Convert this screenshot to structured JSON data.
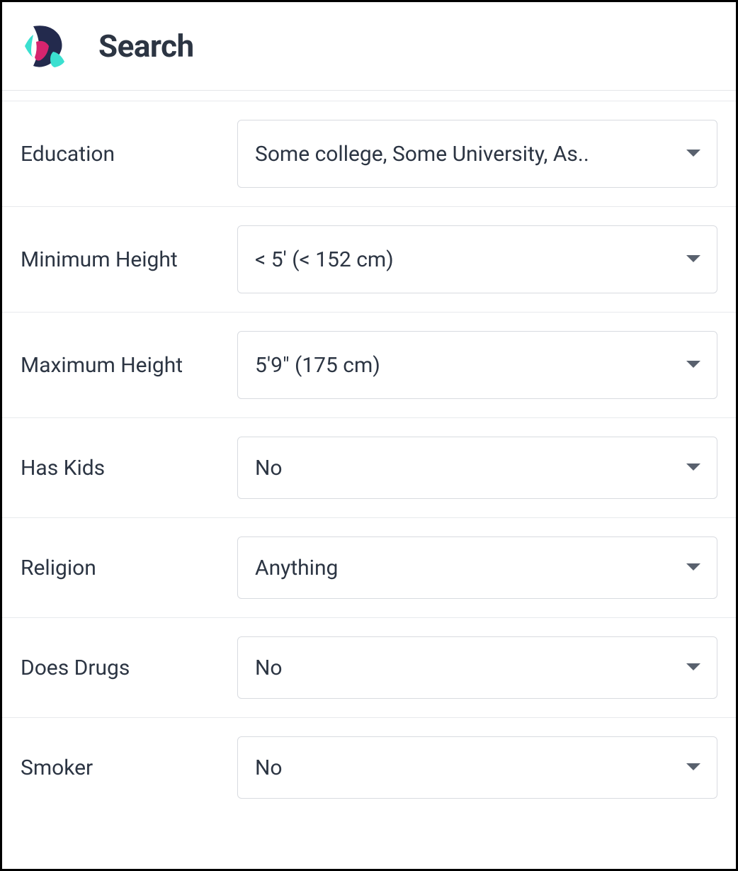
{
  "header": {
    "title": "Search"
  },
  "filters": {
    "education": {
      "label": "Education",
      "value": "Some college, Some University, As.."
    },
    "min_height": {
      "label": "Minimum Height",
      "value": "< 5' (< 152 cm)"
    },
    "max_height": {
      "label": "Maximum Height",
      "value": "5'9\" (175 cm)"
    },
    "has_kids": {
      "label": "Has Kids",
      "value": "No"
    },
    "religion": {
      "label": "Religion",
      "value": "Anything"
    },
    "does_drugs": {
      "label": "Does Drugs",
      "value": "No"
    },
    "smoker": {
      "label": "Smoker",
      "value": "No"
    }
  }
}
